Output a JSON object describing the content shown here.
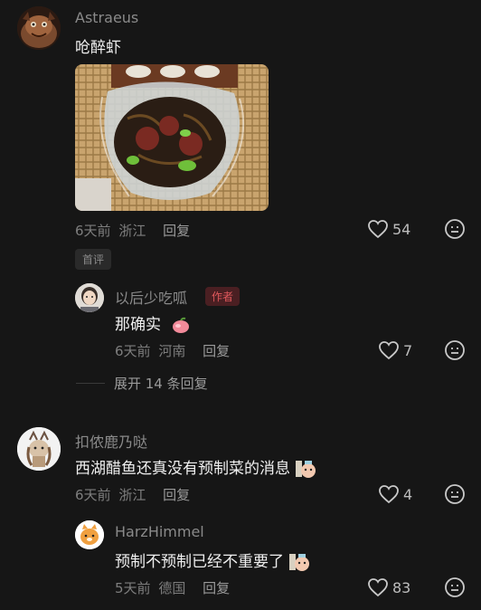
{
  "comments": [
    {
      "username": "Astraeus",
      "text": "呛醉虾",
      "time": "6天前",
      "location": "浙江",
      "reply_label": "回复",
      "likes": "54",
      "badge": "首评"
    },
    {
      "username": "扣侬鹿乃哒",
      "text": "西湖醋鱼还真没有预制菜的消息",
      "time": "6天前",
      "location": "浙江",
      "reply_label": "回复",
      "likes": "4"
    }
  ],
  "replies": [
    {
      "username": "以后少吃呱",
      "author_tag": "作者",
      "text": "那确实",
      "time": "6天前",
      "location": "河南",
      "reply_label": "回复",
      "likes": "7"
    },
    {
      "username": "HarzHimmel",
      "text": "预制不预制已经不重要了",
      "time": "5天前",
      "location": "德国",
      "reply_label": "回复",
      "likes": "83"
    }
  ],
  "expand_label": "展开 14 条回复",
  "icons": {
    "like": "heart-outline-icon",
    "dislike": "meh-face-icon"
  },
  "colors": {
    "background": "#161616",
    "author_tag": "#e0585c"
  }
}
